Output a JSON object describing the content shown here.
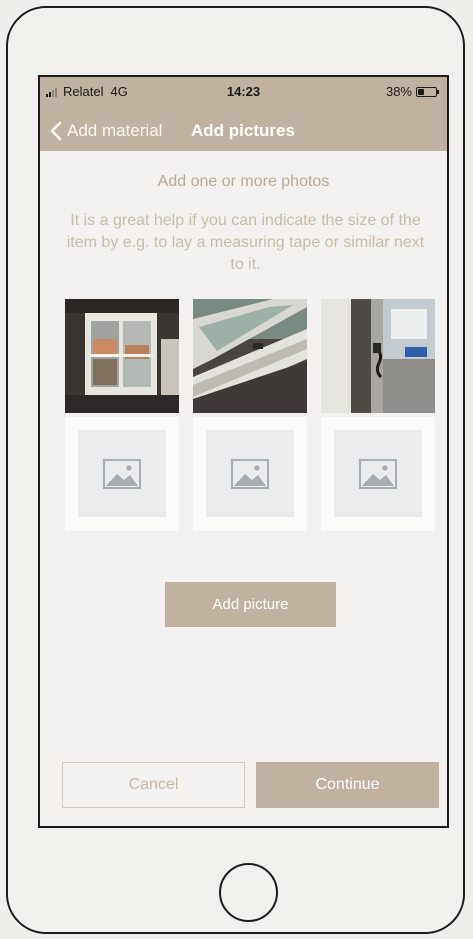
{
  "status_bar": {
    "carrier": "Relatel",
    "network": "4G",
    "time": "14:23",
    "battery_percent": "38%",
    "battery_level": 0.38,
    "signal_bars_on": 2,
    "signal_bars_total": 4
  },
  "nav": {
    "back_label": "Add material",
    "title": "Add pictures"
  },
  "content": {
    "heading": "Add one or more photos",
    "hint": "It is a great help if you can indicate the size of the item by e.g. to lay a measuring tape or similar next to it."
  },
  "photos": [
    {
      "type": "photo",
      "subject": "window-interior"
    },
    {
      "type": "photo",
      "subject": "open-window-frame"
    },
    {
      "type": "photo",
      "subject": "window-latch"
    },
    {
      "type": "placeholder",
      "icon": "image-placeholder-icon"
    },
    {
      "type": "placeholder",
      "icon": "image-placeholder-icon"
    },
    {
      "type": "placeholder",
      "icon": "image-placeholder-icon"
    }
  ],
  "buttons": {
    "add_picture": "Add picture",
    "cancel": "Cancel",
    "continue": "Continue"
  },
  "colors": {
    "accent": "#c0b2a1",
    "text_muted": "#bba994",
    "background": "#f2f1ef"
  }
}
